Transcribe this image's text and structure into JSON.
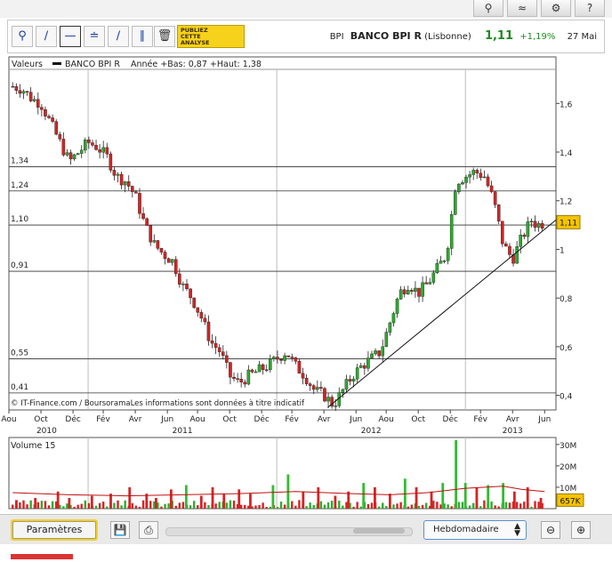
{
  "quote": {
    "ticker": "BPI",
    "name": "BANCO BPI R",
    "market": "(Lisbonne)",
    "price": "1,11",
    "change": "+1,19%",
    "date": "27 Mai"
  },
  "toolbar": {
    "promo_lines": [
      "PUBLIEZ",
      "CETTE",
      "ANALYSE"
    ],
    "icons": [
      "zoom-tool-icon",
      "line-tool-icon",
      "horizontal-line-tool-icon",
      "fibonacci-tool-icon",
      "channel-tool-icon",
      "parallel-lines-tool-icon",
      "trash-icon"
    ]
  },
  "top_icons": [
    "search-icon",
    "compare-icon",
    "settings-icon",
    "help-icon"
  ],
  "bottom": {
    "params_label": "Paramètres",
    "period_value": "Hebdomadaire"
  },
  "chart_data": {
    "type": "candlestick",
    "header_label": "Valeurs",
    "legend": "BANCO BPI R",
    "range_text": "Année +Bas: 0,87 +Haut: 1,38",
    "copyright": "© IT-Finance.com / BoursoramaLes informations sont données à titre indicatif",
    "y_ticks": [
      0.4,
      0.6,
      0.8,
      1.0,
      1.2,
      1.4,
      1.6
    ],
    "y_tick_labels": [
      "0,4",
      "0,6",
      "0,8",
      "1",
      "1,2",
      "1,4",
      "1,6"
    ],
    "y_range": [
      0.34,
      1.74
    ],
    "last_price": 1.11,
    "last_label": "1,11",
    "horizontal_levels": [
      {
        "value": 1.34,
        "label": "1,34"
      },
      {
        "value": 1.24,
        "label": "1,24"
      },
      {
        "value": 1.1,
        "label": "1,10"
      },
      {
        "value": 0.91,
        "label": "0,91"
      },
      {
        "value": 0.55,
        "label": "0,55"
      },
      {
        "value": 0.41,
        "label": "0,41"
      }
    ],
    "trendline": {
      "from": [
        2012.27,
        0.35
      ],
      "to": [
        2013.4,
        1.07
      ]
    },
    "x_range": [
      2010.58,
      2013.48
    ],
    "x_ticks": [
      {
        "t": 2010.58,
        "label": "Aou"
      },
      {
        "t": 2010.75,
        "label": "Oct"
      },
      {
        "t": 2010.92,
        "label": "Déc"
      },
      {
        "t": 2011.08,
        "label": "Fév"
      },
      {
        "t": 2011.25,
        "label": "Avr"
      },
      {
        "t": 2011.42,
        "label": "Jun"
      },
      {
        "t": 2011.58,
        "label": "Aou"
      },
      {
        "t": 2011.75,
        "label": "Oct"
      },
      {
        "t": 2011.92,
        "label": "Déc"
      },
      {
        "t": 2012.08,
        "label": "Fév"
      },
      {
        "t": 2012.25,
        "label": "Avr"
      },
      {
        "t": 2012.42,
        "label": "Jun"
      },
      {
        "t": 2012.58,
        "label": "Aou"
      },
      {
        "t": 2012.75,
        "label": "Oct"
      },
      {
        "t": 2012.92,
        "label": "Déc"
      },
      {
        "t": 2013.08,
        "label": "Fév"
      },
      {
        "t": 2013.25,
        "label": "Avr"
      },
      {
        "t": 2013.42,
        "label": "Jun"
      }
    ],
    "year_labels": [
      {
        "t": 2010.78,
        "label": "2010"
      },
      {
        "t": 2011.5,
        "label": "2011"
      },
      {
        "t": 2012.5,
        "label": "2012"
      },
      {
        "t": 2013.25,
        "label": "2013"
      }
    ],
    "year_separators": [
      2011.0,
      2012.0,
      2013.0
    ],
    "price_path": [
      [
        2010.6,
        1.67
      ],
      [
        2010.65,
        1.66
      ],
      [
        2010.7,
        1.62
      ],
      [
        2010.75,
        1.6
      ],
      [
        2010.8,
        1.52
      ],
      [
        2010.85,
        1.44
      ],
      [
        2010.9,
        1.36
      ],
      [
        2010.95,
        1.4
      ],
      [
        2011.0,
        1.44
      ],
      [
        2011.05,
        1.42
      ],
      [
        2011.1,
        1.38
      ],
      [
        2011.15,
        1.3
      ],
      [
        2011.2,
        1.28
      ],
      [
        2011.25,
        1.22
      ],
      [
        2011.3,
        1.1
      ],
      [
        2011.35,
        1.02
      ],
      [
        2011.4,
        0.98
      ],
      [
        2011.45,
        0.95
      ],
      [
        2011.5,
        0.85
      ],
      [
        2011.55,
        0.8
      ],
      [
        2011.6,
        0.72
      ],
      [
        2011.65,
        0.62
      ],
      [
        2011.7,
        0.58
      ],
      [
        2011.75,
        0.48
      ],
      [
        2011.8,
        0.45
      ],
      [
        2011.85,
        0.48
      ],
      [
        2011.9,
        0.5
      ],
      [
        2011.95,
        0.52
      ],
      [
        2012.0,
        0.55
      ],
      [
        2012.05,
        0.58
      ],
      [
        2012.1,
        0.52
      ],
      [
        2012.15,
        0.48
      ],
      [
        2012.2,
        0.42
      ],
      [
        2012.25,
        0.4
      ],
      [
        2012.3,
        0.36
      ],
      [
        2012.35,
        0.42
      ],
      [
        2012.4,
        0.48
      ],
      [
        2012.45,
        0.52
      ],
      [
        2012.5,
        0.55
      ],
      [
        2012.55,
        0.58
      ],
      [
        2012.6,
        0.7
      ],
      [
        2012.65,
        0.82
      ],
      [
        2012.7,
        0.86
      ],
      [
        2012.75,
        0.82
      ],
      [
        2012.8,
        0.86
      ],
      [
        2012.85,
        0.92
      ],
      [
        2012.9,
        0.98
      ],
      [
        2012.95,
        1.28
      ],
      [
        2013.0,
        1.3
      ],
      [
        2013.05,
        1.32
      ],
      [
        2013.1,
        1.3
      ],
      [
        2013.15,
        1.2
      ],
      [
        2013.2,
        1.02
      ],
      [
        2013.25,
        0.96
      ],
      [
        2013.3,
        1.05
      ],
      [
        2013.35,
        1.12
      ],
      [
        2013.38,
        1.1
      ],
      [
        2013.42,
        1.11
      ]
    ],
    "volume": {
      "label": "Volume 15",
      "y_ticks": [
        10,
        20,
        30
      ],
      "y_tick_labels": [
        "10M",
        "20M",
        "30M"
      ],
      "y_range": [
        0,
        32
      ],
      "last": 4,
      "last_label": "657K",
      "spikes": [
        {
          "t": 2010.62,
          "value": 4
        },
        {
          "t": 2010.72,
          "value": 5
        },
        {
          "t": 2010.84,
          "value": 8
        },
        {
          "t": 2010.9,
          "value": 5
        },
        {
          "t": 2011.02,
          "value": 6
        },
        {
          "t": 2011.12,
          "value": 7
        },
        {
          "t": 2011.22,
          "value": 10
        },
        {
          "t": 2011.31,
          "value": 7
        },
        {
          "t": 2011.36,
          "value": 5
        },
        {
          "t": 2011.44,
          "value": 9
        },
        {
          "t": 2011.52,
          "value": 11
        },
        {
          "t": 2011.6,
          "value": 6
        },
        {
          "t": 2011.66,
          "value": 10
        },
        {
          "t": 2011.72,
          "value": 7
        },
        {
          "t": 2011.8,
          "value": 9
        },
        {
          "t": 2011.86,
          "value": 7
        },
        {
          "t": 2011.98,
          "value": 11
        },
        {
          "t": 2012.06,
          "value": 16
        },
        {
          "t": 2012.14,
          "value": 8
        },
        {
          "t": 2012.22,
          "value": 10
        },
        {
          "t": 2012.31,
          "value": 6
        },
        {
          "t": 2012.38,
          "value": 8
        },
        {
          "t": 2012.46,
          "value": 12
        },
        {
          "t": 2012.52,
          "value": 10
        },
        {
          "t": 2012.6,
          "value": 7
        },
        {
          "t": 2012.68,
          "value": 14
        },
        {
          "t": 2012.74,
          "value": 10
        },
        {
          "t": 2012.82,
          "value": 8
        },
        {
          "t": 2012.88,
          "value": 12
        },
        {
          "t": 2012.95,
          "value": 32
        },
        {
          "t": 2013.0,
          "value": 12
        },
        {
          "t": 2013.06,
          "value": 10
        },
        {
          "t": 2013.12,
          "value": 11
        },
        {
          "t": 2013.2,
          "value": 12
        },
        {
          "t": 2013.26,
          "value": 8
        },
        {
          "t": 2013.33,
          "value": 10
        },
        {
          "t": 2013.4,
          "value": 5
        }
      ],
      "avg_path": [
        [
          2010.6,
          7.5
        ],
        [
          2010.9,
          6.5
        ],
        [
          2011.2,
          6.0
        ],
        [
          2011.5,
          6.5
        ],
        [
          2011.8,
          7.0
        ],
        [
          2012.1,
          8.0
        ],
        [
          2012.4,
          7.0
        ],
        [
          2012.6,
          6.5
        ],
        [
          2012.8,
          7.5
        ],
        [
          2013.0,
          9.5
        ],
        [
          2013.2,
          10.5
        ],
        [
          2013.3,
          9.0
        ],
        [
          2013.42,
          8.0
        ]
      ]
    }
  }
}
